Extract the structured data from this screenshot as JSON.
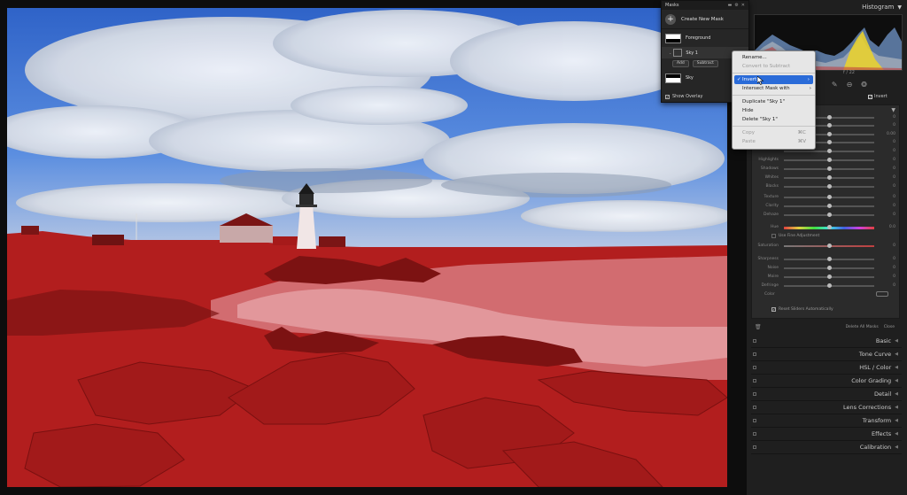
{
  "masks_panel": {
    "title": "Masks",
    "create_label": "Create New Mask",
    "masks": [
      {
        "name": "Foreground",
        "thumb": "foreground-thumb"
      },
      {
        "name": "Sky",
        "thumb": "sky-thumb"
      }
    ],
    "active_component": "Sky 1",
    "add_label": "Add",
    "subtract_label": "Subtract",
    "show_overlay_label": "Show Overlay"
  },
  "context_menu": {
    "items": [
      {
        "label": "Rename...",
        "state": "normal"
      },
      {
        "label": "Convert to Subtract",
        "state": "disabled"
      },
      {
        "label": "Invert",
        "state": "active",
        "checked": true,
        "submenu": true
      },
      {
        "label": "Intersect Mask with",
        "state": "normal",
        "submenu": true
      },
      {
        "label": "Duplicate \"Sky 1\"",
        "state": "normal"
      },
      {
        "label": "Hide",
        "state": "normal"
      },
      {
        "label": "Delete \"Sky 1\"",
        "state": "normal"
      },
      {
        "label": "Copy",
        "state": "disabled",
        "shortcut": "⌘C"
      },
      {
        "label": "Paste",
        "state": "disabled",
        "shortcut": "⌘V"
      }
    ]
  },
  "right_panel": {
    "histogram_title": "Histogram",
    "histogram_info": "f / 22",
    "invert_label": "Invert",
    "sliders": [
      {
        "label": "",
        "val": "0",
        "pos": 0.5
      },
      {
        "label": "",
        "val": "0",
        "pos": 0.5
      },
      {
        "label": "",
        "val": "0.00",
        "pos": 0.5
      },
      {
        "label": "",
        "val": "0",
        "pos": 0.5
      },
      {
        "label": "",
        "val": "0",
        "pos": 0.5
      },
      {
        "label": "Highlights",
        "val": "0",
        "pos": 0.5
      },
      {
        "label": "Shadows",
        "val": "0",
        "pos": 0.5
      },
      {
        "label": "Whites",
        "val": "0",
        "pos": 0.5
      },
      {
        "label": "Blacks",
        "val": "0",
        "pos": 0.5
      },
      {
        "label": "Texture",
        "val": "0",
        "pos": 0.5
      },
      {
        "label": "Clarity",
        "val": "0",
        "pos": 0.5
      },
      {
        "label": "Dehaze",
        "val": "0",
        "pos": 0.5
      },
      {
        "label": "Hue",
        "val": "0.0",
        "pos": 0.5
      },
      {
        "label": "Saturation",
        "val": "0",
        "pos": 0.5
      },
      {
        "label": "Sharpness",
        "val": "0",
        "pos": 0.5
      },
      {
        "label": "Noise",
        "val": "0",
        "pos": 0.5
      },
      {
        "label": "Moire",
        "val": "0",
        "pos": 0.5
      },
      {
        "label": "Defringe",
        "val": "0",
        "pos": 0.5
      }
    ],
    "use_fine_label": "Use Fine Adjustment",
    "color_label": "Color",
    "reset_label": "Reset Sliders Automatically",
    "delete_all_label": "Delete All Masks",
    "close_label": "Close",
    "sections": [
      "Basic",
      "Tone Curve",
      "HSL / Color",
      "Color Grading",
      "Detail",
      "Lens Corrections",
      "Transform",
      "Effects",
      "Calibration"
    ]
  }
}
